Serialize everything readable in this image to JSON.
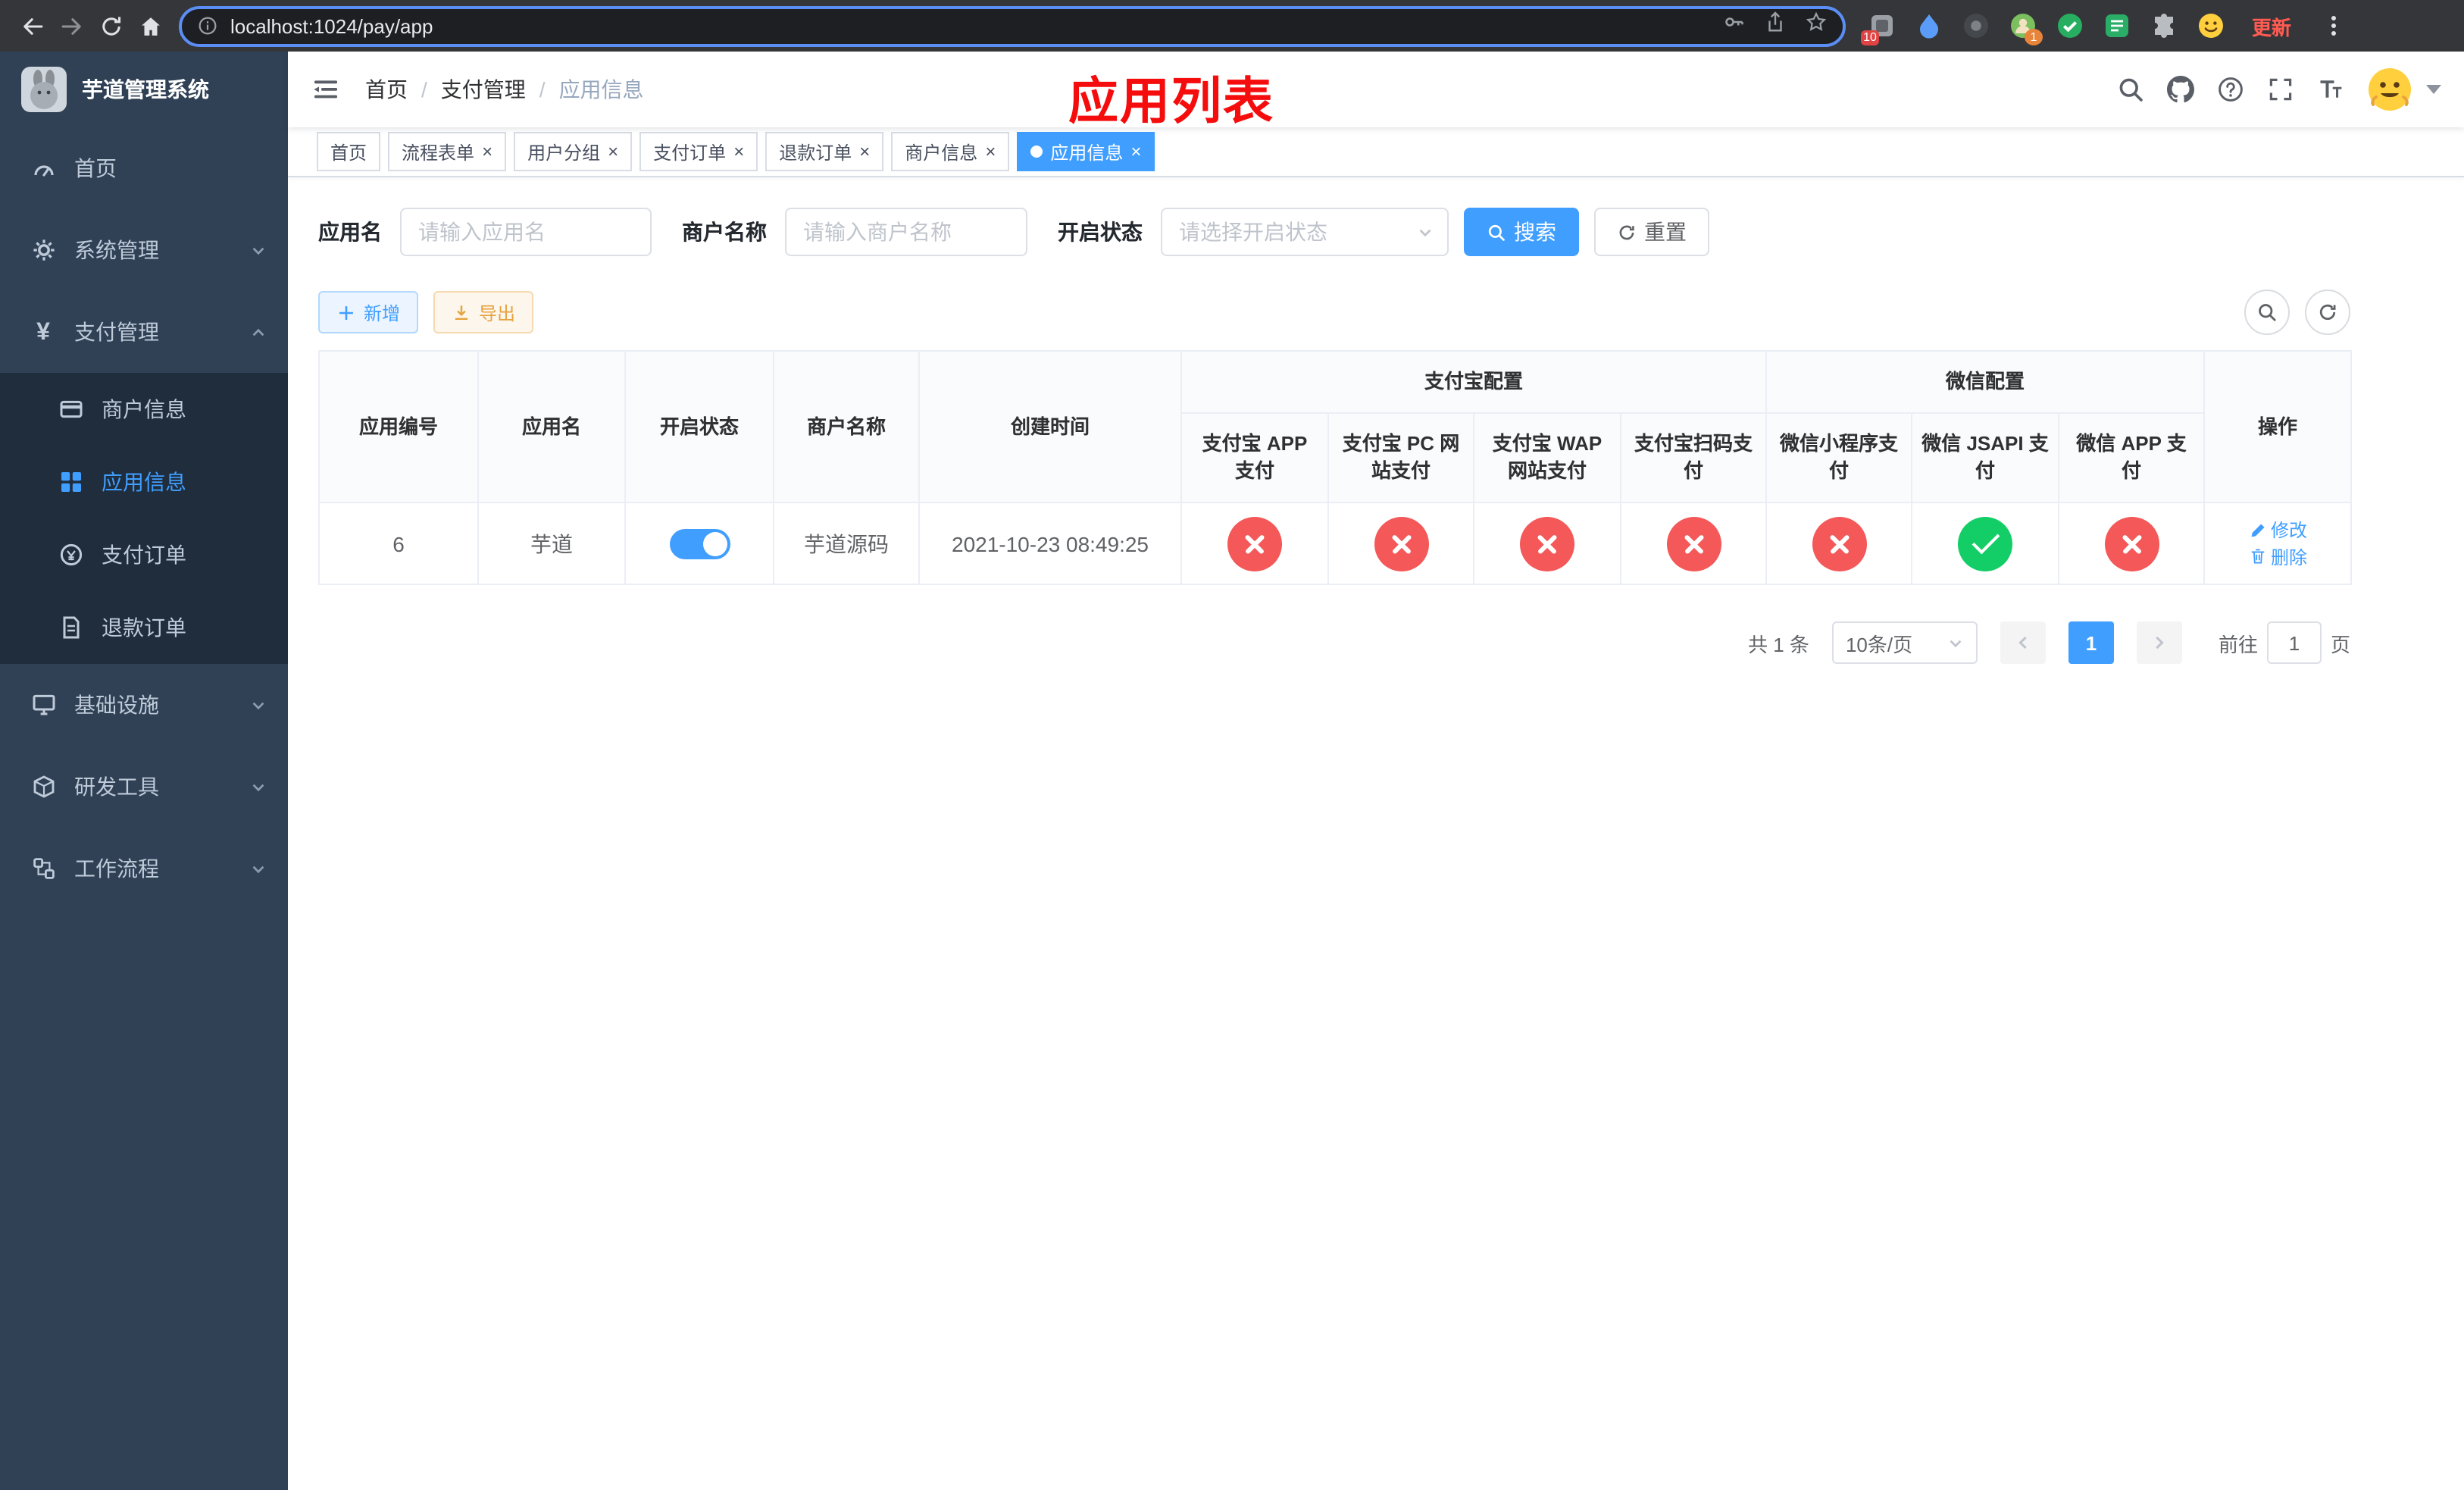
{
  "browser": {
    "url": "localhost:1024/pay/app",
    "update_label": "更新",
    "ext_badge_pin": "10",
    "ext_badge_avatar": "1"
  },
  "sidebar": {
    "logo_title": "芋道管理系统",
    "items": [
      {
        "label": "首页"
      },
      {
        "label": "系统管理"
      },
      {
        "label": "支付管理"
      },
      {
        "label": "商户信息"
      },
      {
        "label": "应用信息"
      },
      {
        "label": "支付订单"
      },
      {
        "label": "退款订单"
      },
      {
        "label": "基础设施"
      },
      {
        "label": "研发工具"
      },
      {
        "label": "工作流程"
      }
    ]
  },
  "header": {
    "breadcrumb": [
      "首页",
      "支付管理",
      "应用信息"
    ],
    "overlay_title": "应用列表"
  },
  "tabs": [
    "首页",
    "流程表单",
    "用户分组",
    "支付订单",
    "退款订单",
    "商户信息",
    "应用信息"
  ],
  "filters": {
    "app_name_label": "应用名",
    "app_name_placeholder": "请输入应用名",
    "merchant_label": "商户名称",
    "merchant_placeholder": "请输入商户名称",
    "status_label": "开启状态",
    "status_placeholder": "请选择开启状态",
    "search_label": "搜索",
    "reset_label": "重置"
  },
  "toolbar": {
    "add_label": "新增",
    "export_label": "导出"
  },
  "table": {
    "groups": {
      "alipay": "支付宝配置",
      "wechat": "微信配置"
    },
    "columns": [
      "应用编号",
      "应用名",
      "开启状态",
      "商户名称",
      "创建时间",
      "支付宝 APP 支付",
      "支付宝 PC 网站支付",
      "支付宝 WAP 网站支付",
      "支付宝扫码支付",
      "微信小程序支付",
      "微信 JSAPI 支付",
      "微信 APP 支付",
      "操作"
    ],
    "rows": [
      {
        "id": "6",
        "name": "芋道",
        "enabled": true,
        "merchant": "芋道源码",
        "created_at": "2021-10-23 08:49:25",
        "alipay_app": false,
        "alipay_pc": false,
        "alipay_wap": false,
        "alipay_qr": false,
        "wechat_mini": false,
        "wechat_jsapi": true,
        "wechat_app": false,
        "edit_label": "修改",
        "delete_label": "删除"
      }
    ]
  },
  "pagination": {
    "total_label": "共 1 条",
    "page_size_label": "10条/页",
    "current_page": "1",
    "goto_label": "前往",
    "goto_value": "1",
    "page_unit_label": "页"
  },
  "colors": {
    "accent": "#409eff",
    "danger": "#f45858",
    "success": "#13ce66",
    "title_red": "#f50d0d",
    "sidebar_bg": "#304156",
    "submenu_bg": "#1f2d3d"
  }
}
